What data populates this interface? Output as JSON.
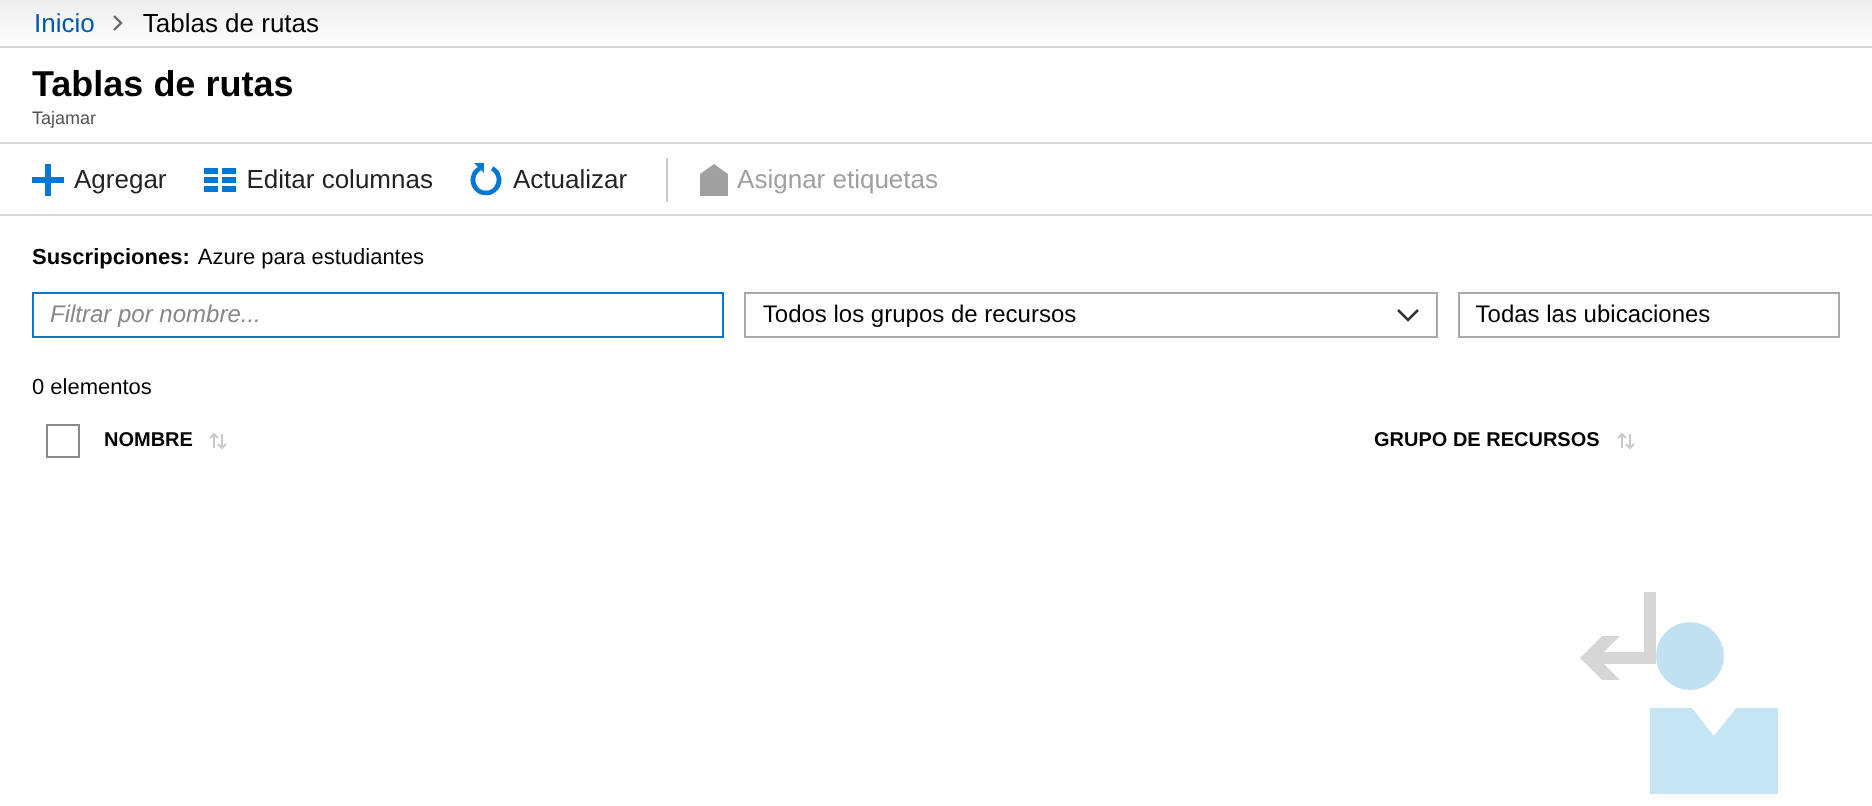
{
  "breadcrumb": [
    {
      "label": "Inicio",
      "link": true
    },
    {
      "label": "Tablas de rutas",
      "link": false
    }
  ],
  "page": {
    "title": "Tablas de rutas",
    "subtitle": "Tajamar"
  },
  "toolbar": [
    {
      "kind": "add",
      "label": "Agregar",
      "disabled": false
    },
    {
      "kind": "columns",
      "label": "Editar columnas",
      "disabled": false
    },
    {
      "kind": "refresh",
      "label": "Actualizar",
      "disabled": false
    },
    {
      "kind": "tag",
      "label": "Asignar etiquetas",
      "disabled": true
    }
  ],
  "subscription": {
    "label": "Suscripciones:",
    "value": "Azure para estudiantes"
  },
  "filter": {
    "placeholder": "Filtrar por nombre..."
  },
  "dropdowns": [
    {
      "value": "Todos los grupos de recursos",
      "caret": true
    },
    {
      "value": "Todas las ubicaciones",
      "caret": false
    }
  ],
  "count": "0 elementos",
  "table": {
    "select_all": {
      "checked": false
    },
    "columns": [
      "NOMBRE",
      "GRUPO DE RECURSOS"
    ]
  }
}
